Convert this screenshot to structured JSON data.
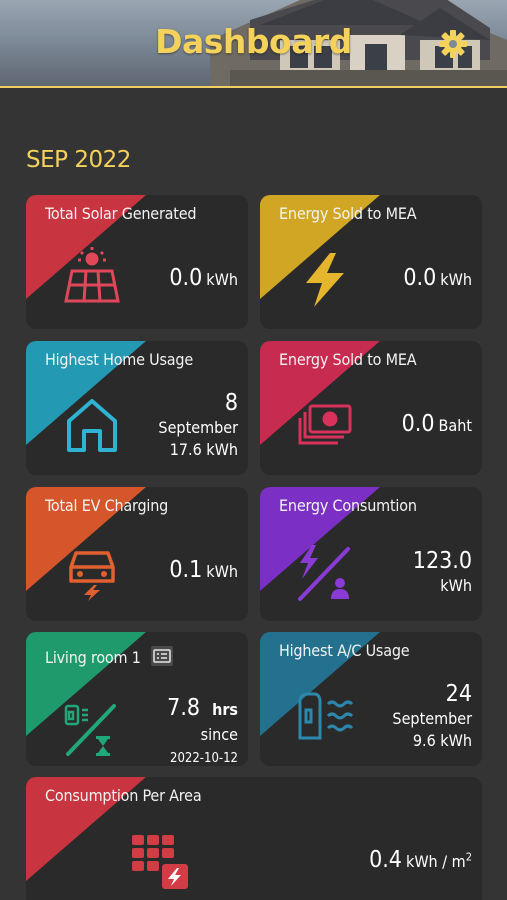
{
  "header": {
    "title": "Dashboard"
  },
  "month": "SEP 2022",
  "cards": {
    "solar": {
      "title": "Total Solar Generated",
      "value": "0.0",
      "unit": "kWh"
    },
    "sold_kwh": {
      "title": "Energy Sold to MEA",
      "value": "0.0",
      "unit": "kWh"
    },
    "home_usage": {
      "title": "Highest Home Usage",
      "day": "8",
      "month": "September",
      "amount": "17.6 kWh"
    },
    "sold_baht": {
      "title": "Energy Sold to MEA",
      "value": "0.0",
      "unit": "Baht"
    },
    "ev": {
      "title": "Total EV Charging",
      "value": "0.1",
      "unit": "kWh"
    },
    "consumption": {
      "title": "Energy Consumtion",
      "value": "123.0",
      "unit": "kWh"
    },
    "living": {
      "title": "Living room 1",
      "value": "7.8",
      "unit": "hrs",
      "since_label": "since",
      "since_date": "2022-10-12"
    },
    "ac": {
      "title": "Highest A/C Usage",
      "day": "24",
      "month": "September",
      "amount": "9.6 kWh"
    },
    "area": {
      "title": "Consumption Per Area",
      "value": "0.4",
      "unit": "kWh / m",
      "unit_sup": "2"
    }
  },
  "colors": {
    "accent": "#f4d25c",
    "solar": "#c8343f",
    "sold_kwh": "#d1a625",
    "home": "#2499b4",
    "sold_baht": "#c72b50",
    "ev": "#d5562b",
    "consumption": "#7b2fc4",
    "living": "#1f9a6c",
    "ac": "#23718f",
    "area": "#c8343f"
  },
  "icons": [
    "gear-icon",
    "solar-panel-icon",
    "lightning-icon",
    "house-icon",
    "money-icon",
    "ev-car-icon",
    "consumption-icon",
    "sensor-card-icon",
    "sensor-hourglass-icon",
    "ac-icon",
    "grid-area-icon"
  ]
}
